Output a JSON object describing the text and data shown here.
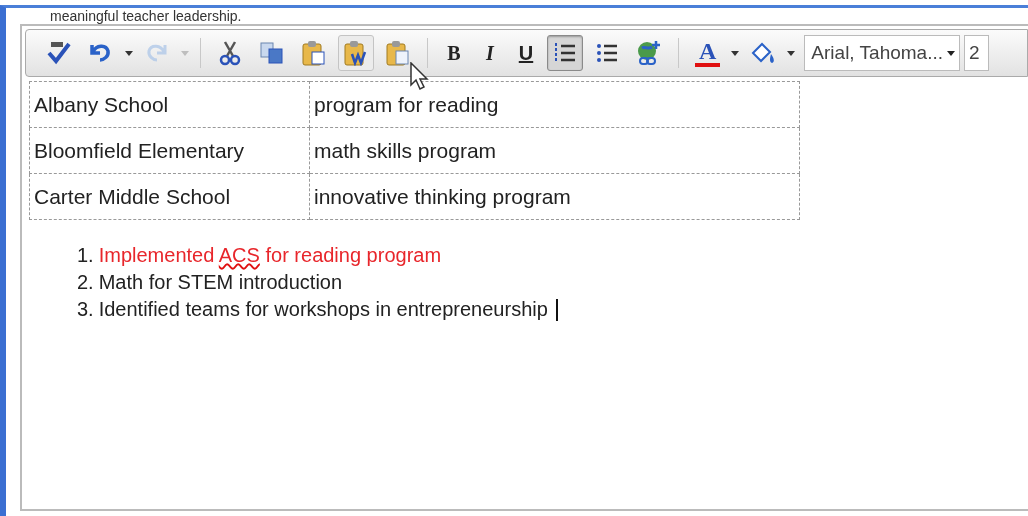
{
  "header_text": "meaningful teacher leadership.",
  "toolbar": {
    "buttons": [
      {
        "kind": "spellcheck",
        "disabled": false
      },
      {
        "kind": "undo",
        "disabled": false,
        "selected": false,
        "hovered": false
      },
      {
        "kind": "dropdown",
        "disabled": false,
        "selected": false,
        "hovered": false
      },
      {
        "kind": "redo",
        "disabled": true,
        "selected": false,
        "hovered": false
      },
      {
        "kind": "dropdown",
        "disabled": true,
        "selected": false,
        "hovered": false
      },
      {
        "kind": "separator"
      },
      {
        "kind": "cut",
        "disabled": false,
        "selected": false,
        "hovered": false
      },
      {
        "kind": "copy",
        "disabled": false,
        "selected": false,
        "hovered": false
      },
      {
        "kind": "paste",
        "disabled": false,
        "selected": false,
        "hovered": false
      },
      {
        "kind": "paste-word",
        "disabled": false,
        "selected": false,
        "hovered": true
      },
      {
        "kind": "paste-plain",
        "disabled": false,
        "selected": false,
        "hovered": false
      },
      {
        "kind": "separator"
      },
      {
        "kind": "bold",
        "label": "B",
        "disabled": false,
        "selected": false,
        "hovered": false
      },
      {
        "kind": "italic",
        "label": "I",
        "disabled": false,
        "selected": false,
        "hovered": false
      },
      {
        "kind": "underline",
        "label": "U",
        "disabled": false,
        "selected": false,
        "hovered": false
      },
      {
        "kind": "numbered-list",
        "disabled": false,
        "selected": true,
        "hovered": false
      },
      {
        "kind": "bulleted-list",
        "disabled": false,
        "selected": false,
        "hovered": false
      },
      {
        "kind": "link",
        "disabled": false,
        "selected": false,
        "hovered": false
      },
      {
        "kind": "separator"
      },
      {
        "kind": "font-color",
        "label": "A",
        "disabled": false,
        "selected": false,
        "hovered": false
      },
      {
        "kind": "dropdown",
        "disabled": false,
        "selected": false,
        "hovered": false
      },
      {
        "kind": "highlight",
        "disabled": false,
        "selected": false,
        "hovered": false
      },
      {
        "kind": "dropdown",
        "disabled": false,
        "selected": false,
        "hovered": false
      }
    ],
    "font_family": "Arial, Tahoma...",
    "font_size": "2"
  },
  "table": {
    "rows": [
      [
        "Albany School",
        "program for reading"
      ],
      [
        "Bloomfield Elementary",
        "math skills program"
      ],
      [
        "Carter Middle School",
        "innovative thinking program"
      ]
    ]
  },
  "list": [
    {
      "number": "1.",
      "color": "#e8262b",
      "parts": [
        {
          "text": "Implemented ",
          "misspelled": false
        },
        {
          "text": "ACS",
          "misspelled": true
        },
        {
          "text": " for reading program",
          "misspelled": false
        }
      ]
    },
    {
      "number": "2.",
      "color": "#222222",
      "parts": [
        {
          "text": "Math for STEM introduction",
          "misspelled": false
        }
      ]
    },
    {
      "number": "3.",
      "color": "#222222",
      "parts": [
        {
          "text": "Identified teams for workshops in entrepreneurship",
          "misspelled": false
        }
      ],
      "caret": true
    }
  ]
}
